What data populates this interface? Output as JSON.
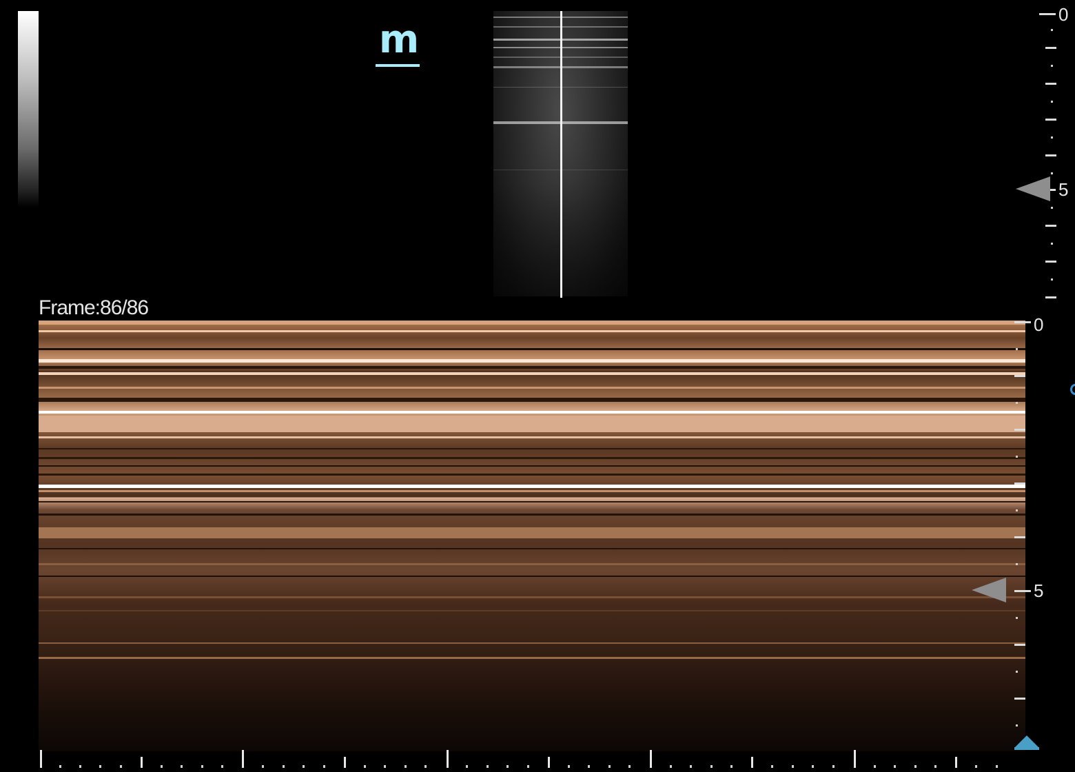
{
  "mode_label": "m",
  "frame_label": "Frame:86/86",
  "bmode_depth_scale": {
    "labels": [
      "0",
      "5"
    ]
  },
  "mmode_depth_scale": {
    "labels": [
      "0",
      "5"
    ]
  },
  "colors": {
    "mode_label": "#a9ecfb",
    "mmode_tint": "#b37c55",
    "timeline_marker": "#4a9fc6",
    "focus_marker": "#8e8e8e"
  },
  "icons": {
    "focus_marker": "focus-triangle-icon",
    "timeline_marker": "timeline-position-icon",
    "edge_indicator": "edge-circle-icon"
  }
}
